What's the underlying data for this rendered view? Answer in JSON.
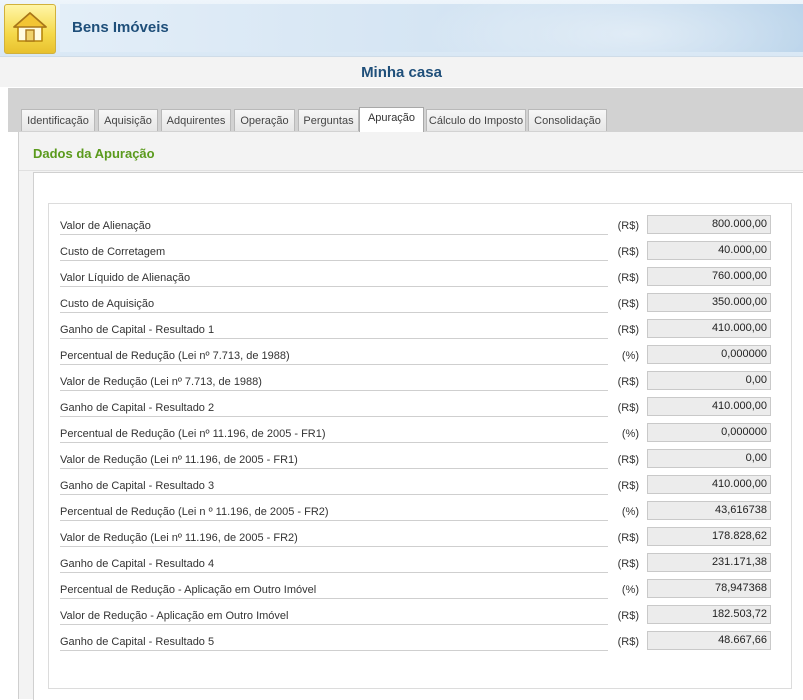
{
  "header": {
    "title": "Bens Imóveis",
    "home_icon": "home-icon"
  },
  "page": {
    "title": "Minha casa"
  },
  "tabs": [
    {
      "label": "Identificação"
    },
    {
      "label": "Aquisição"
    },
    {
      "label": "Adquirentes"
    },
    {
      "label": "Operação"
    },
    {
      "label": "Perguntas"
    },
    {
      "label": "Apuração",
      "active": true
    },
    {
      "label": "Cálculo do Imposto"
    },
    {
      "label": "Consolidação"
    }
  ],
  "section": {
    "title": "Dados da Apuração"
  },
  "rows": [
    {
      "label": "Valor de Alienação",
      "unit": "(R$)",
      "value": "800.000,00"
    },
    {
      "label": "Custo de Corretagem",
      "unit": "(R$)",
      "value": "40.000,00"
    },
    {
      "label": "Valor Líquido de Alienação",
      "unit": "(R$)",
      "value": "760.000,00"
    },
    {
      "label": "Custo de Aquisição",
      "unit": "(R$)",
      "value": "350.000,00"
    },
    {
      "label": "Ganho de Capital - Resultado 1",
      "unit": "(R$)",
      "value": "410.000,00"
    },
    {
      "label": "Percentual de Redução (Lei nº 7.713, de 1988)",
      "unit": "(%)",
      "value": "0,000000"
    },
    {
      "label": "Valor de Redução (Lei nº 7.713, de 1988)",
      "unit": "(R$)",
      "value": "0,00"
    },
    {
      "label": "Ganho de Capital - Resultado 2",
      "unit": "(R$)",
      "value": "410.000,00"
    },
    {
      "label": "Percentual de Redução (Lei nº 11.196, de 2005 - FR1)",
      "unit": "(%)",
      "value": "0,000000"
    },
    {
      "label": "Valor de Redução (Lei nº 11.196, de 2005 - FR1)",
      "unit": "(R$)",
      "value": "0,00"
    },
    {
      "label": "Ganho de Capital - Resultado 3",
      "unit": "(R$)",
      "value": "410.000,00"
    },
    {
      "label": "Percentual de Redução (Lei n º 11.196, de 2005 - FR2)",
      "unit": "(%)",
      "value": "43,616738"
    },
    {
      "label": "Valor de Redução (Lei nº 11.196, de 2005 - FR2)",
      "unit": "(R$)",
      "value": "178.828,62"
    },
    {
      "label": "Ganho de Capital - Resultado 4",
      "unit": "(R$)",
      "value": "231.171,38"
    },
    {
      "label": "Percentual de Redução - Aplicação em Outro Imóvel",
      "unit": "(%)",
      "value": "78,947368"
    },
    {
      "label": "Valor de Redução - Aplicação em Outro Imóvel",
      "unit": "(R$)",
      "value": "182.503,72"
    },
    {
      "label": "Ganho de Capital - Resultado 5",
      "unit": "(R$)",
      "value": "48.667,66"
    }
  ]
}
